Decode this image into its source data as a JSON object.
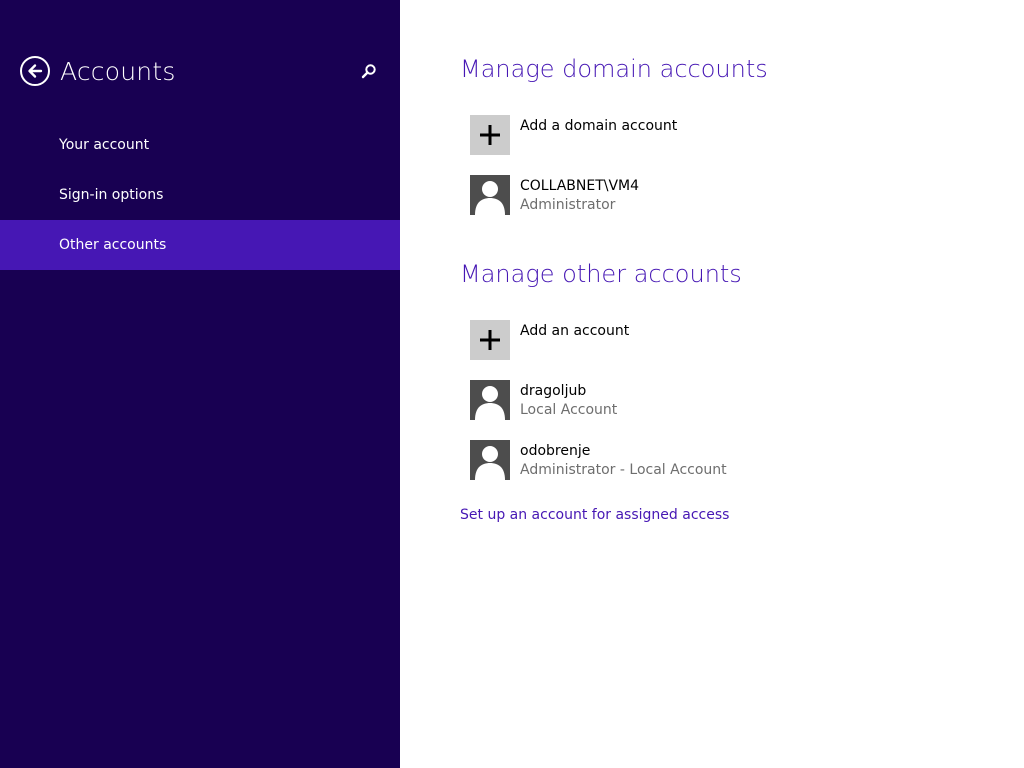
{
  "sidebar": {
    "title": "Accounts",
    "items": [
      {
        "label": "Your account"
      },
      {
        "label": "Sign-in options"
      },
      {
        "label": "Other accounts"
      }
    ]
  },
  "main": {
    "domain_section": {
      "title": "Manage domain accounts",
      "add_label": "Add a domain account",
      "accounts": [
        {
          "name": "COLLABNET\\VM4",
          "type": "Administrator"
        }
      ]
    },
    "other_section": {
      "title": "Manage other accounts",
      "add_label": "Add an account",
      "accounts": [
        {
          "name": "dragoljub",
          "type": "Local Account"
        },
        {
          "name": "odobrenje",
          "type": "Administrator - Local Account"
        }
      ]
    },
    "assigned_access_link": "Set up an account for assigned access"
  },
  "icons": {
    "back": "back-arrow-icon",
    "search": "search-icon",
    "add": "plus-icon",
    "user": "user-avatar-icon"
  },
  "colors": {
    "sidebar_bg": "#180052",
    "selected_bg": "#4617b4",
    "accent": "#4617b4"
  }
}
